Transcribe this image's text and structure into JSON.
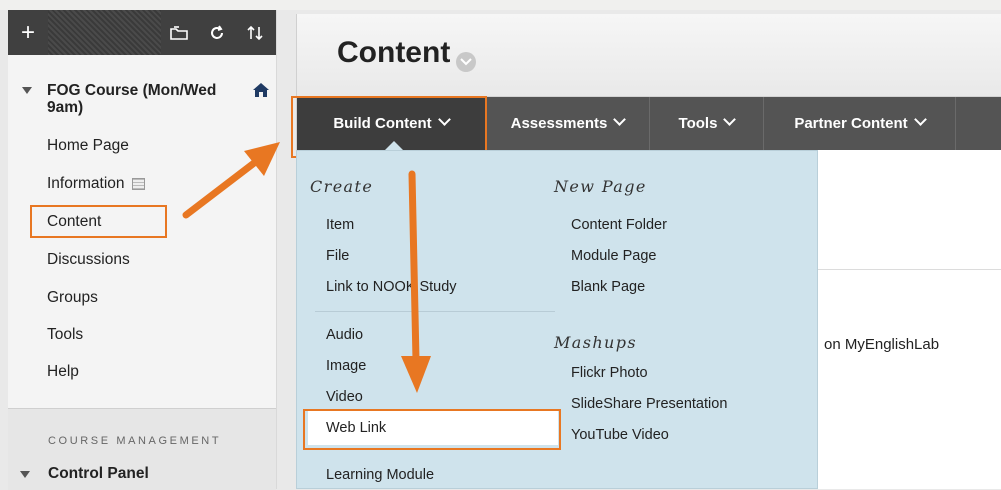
{
  "sidebar": {
    "toolbar": {
      "add_symbol": "+"
    },
    "course_title": "FOG Course (Mon/Wed 9am)",
    "items": [
      {
        "label": "Home Page"
      },
      {
        "label": "Information"
      },
      {
        "label": "Content"
      },
      {
        "label": "Discussions"
      },
      {
        "label": "Groups"
      },
      {
        "label": "Tools"
      },
      {
        "label": "Help"
      }
    ],
    "management_label": "COURSE MANAGEMENT",
    "control_panel": "Control Panel"
  },
  "main": {
    "page_title": "Content",
    "menu": [
      {
        "label": "Build Content"
      },
      {
        "label": "Assessments"
      },
      {
        "label": "Tools"
      },
      {
        "label": "Partner Content"
      }
    ],
    "partial_text": "on MyEnglishLab"
  },
  "dropdown": {
    "create": {
      "heading": "Create",
      "items": [
        "Item",
        "File",
        "Link to NOOK Study",
        "Audio",
        "Image",
        "Video",
        "Web Link",
        "Learning Module"
      ]
    },
    "new_page": {
      "heading": "New Page",
      "items": [
        "Content Folder",
        "Module Page",
        "Blank Page"
      ]
    },
    "mashups": {
      "heading": "Mashups",
      "items": [
        "Flickr Photo",
        "SlideShare Presentation",
        "YouTube Video"
      ]
    }
  },
  "colors": {
    "highlight": "#e87722",
    "menubar": "#545454",
    "dropdown_bg": "#cfe3ec",
    "sidebar_toolbar": "#404040"
  },
  "icons": [
    "plus-icon",
    "folder-icon",
    "refresh-icon",
    "sort-icon",
    "home-icon",
    "info-icon",
    "chevron-down-icon",
    "triangle-down-icon",
    "annotation-arrow"
  ]
}
